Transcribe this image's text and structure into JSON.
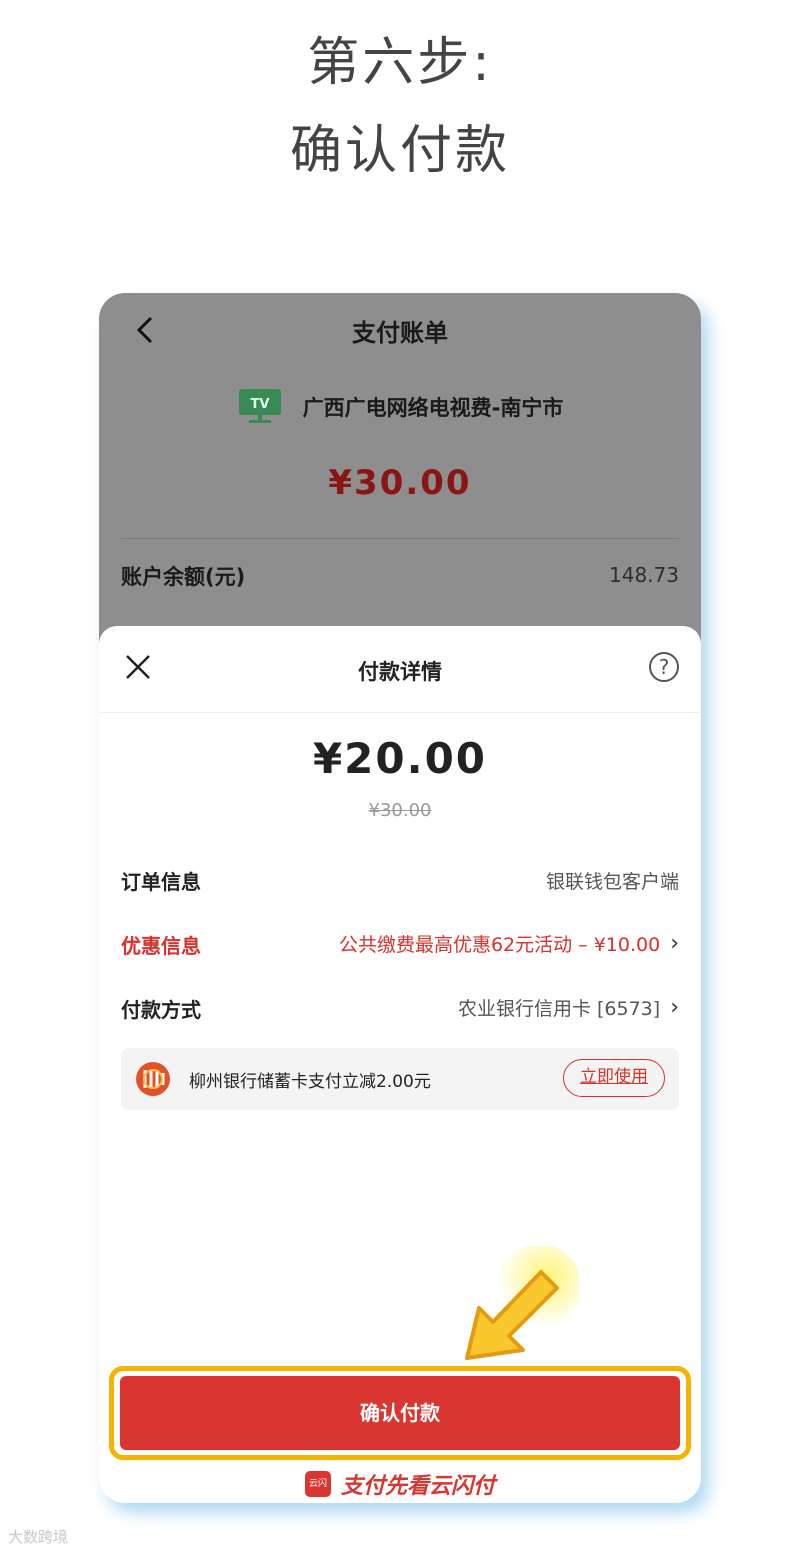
{
  "heading": {
    "line1": "第六步:",
    "line2": "确认付款"
  },
  "bill": {
    "title": "支付账单",
    "tv_icon_label": "TV",
    "merchant": "广西广电网络电视费-南宁市",
    "amount": "¥30.00",
    "balance_label": "账户余额(元)",
    "balance_value": "148.73"
  },
  "sheet": {
    "title": "付款详情",
    "help_symbol": "?",
    "pay_amount": "¥20.00",
    "original_amount": "¥30.00",
    "rows": [
      {
        "label": "订单信息",
        "value": "银联钱包客户端"
      },
      {
        "label": "优惠信息",
        "value": "公共缴费最高优惠62元活动 – ¥10.00"
      },
      {
        "label": "付款方式",
        "value": "农业银行信用卡 [6573]"
      }
    ],
    "chevron": "›",
    "promo": {
      "text": "柳州银行储蓄卡支付立减2.00元",
      "button": "立即使用"
    },
    "confirm_button": "确认付款"
  },
  "brand": {
    "logo_text": "云闪付",
    "slogan": "支付先看云闪付"
  },
  "watermark": "大数跨境",
  "colors": {
    "accent_red": "#d93631",
    "highlight_yellow": "#f5b400",
    "tv_green": "#3a9a5c"
  },
  "icons": [
    "back-arrow-icon",
    "tv-icon",
    "close-icon",
    "help-icon",
    "chevron-right-icon",
    "bank-logo-icon",
    "pointer-arrow-icon"
  ]
}
